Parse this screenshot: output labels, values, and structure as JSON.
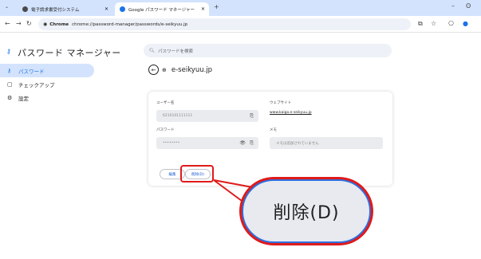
{
  "tabs": [
    {
      "label": "電子請求書受付システム",
      "active": false
    },
    {
      "label": "Google パスワード マネージャー",
      "active": true
    }
  ],
  "new_tab": "+",
  "address": {
    "chip": "Chrome",
    "url": "chrome://password-manager/passwords/e-seikyuu.jp"
  },
  "app": {
    "title": "パスワード マネージャー",
    "search_placeholder": "パスワードを検索"
  },
  "sidebar": {
    "items": [
      {
        "label": "パスワード",
        "active": true
      },
      {
        "label": "チェックアップ",
        "active": false
      },
      {
        "label": "設定",
        "active": false
      }
    ]
  },
  "detail": {
    "site": "e-seikyuu.jp",
    "username_label": "ユーザー名",
    "username_value": "6210101111111",
    "website_label": "ウェブサイト",
    "website_value": "www.kaigo.e-seikyuu.jp",
    "password_label": "パスワード",
    "password_value": "••••••••",
    "note_label": "メモ",
    "note_placeholder": "メモは追加されていません",
    "edit_label": "編集",
    "delete_label": "削除(D)"
  },
  "zoom_label": "削除(D)",
  "colors": {
    "accent": "#1a73e8",
    "tabstrip": "#d3e3fd",
    "highlight": "#e01a1a"
  }
}
